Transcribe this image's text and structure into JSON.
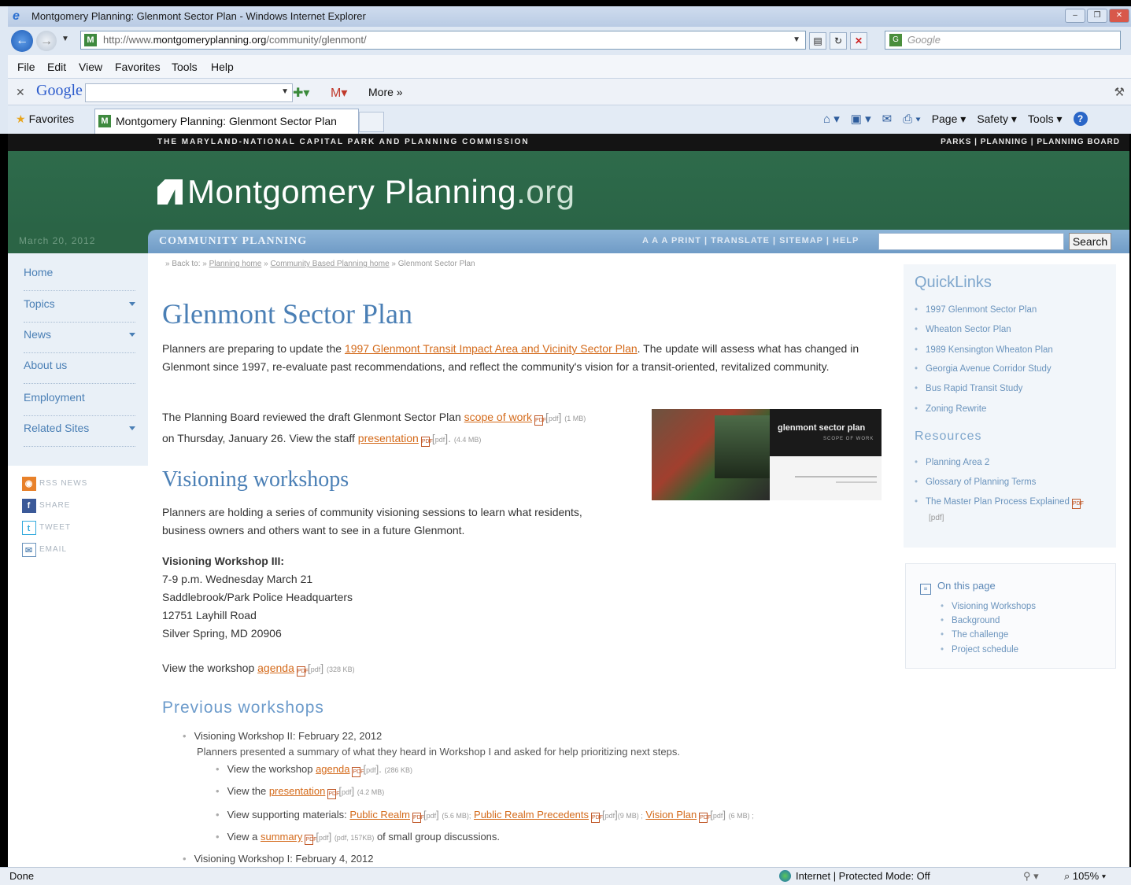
{
  "browser": {
    "title": "Montgomery Planning: Glenmont Sector Plan - Windows Internet Explorer",
    "url_prefix": "http://www.",
    "url_domain": "montgomeryplanning.org",
    "url_path": "/community/glenmont/",
    "search_placeholder": "Google",
    "menu": [
      "File",
      "Edit",
      "View",
      "Favorites",
      "Tools",
      "Help"
    ],
    "google_toolbar": {
      "logo": "Google",
      "more": "More »"
    },
    "favorites_label": "Favorites",
    "tab_title": "Montgomery Planning: Glenmont Sector Plan",
    "commands": {
      "page": "Page ▾",
      "safety": "Safety ▾",
      "tools": "Tools ▾"
    },
    "status": {
      "left": "Done",
      "zone": "Internet | Protected Mode: Off",
      "zoom": "105%"
    }
  },
  "site": {
    "org_bar": "THE MARYLAND-NATIONAL CAPITAL PARK AND PLANNING COMMISSION",
    "org_links": "PARKS  |  PLANNING  |  PLANNING BOARD",
    "logo_main": "Montgomery Planning",
    "logo_org": ".org",
    "date": "March 20, 2012",
    "section_title": "COMMUNITY PLANNING",
    "tools": "A A A  PRINT | TRANSLATE | SITEMAP | HELP",
    "search_button": "Search"
  },
  "leftnav": [
    {
      "label": "Home"
    },
    {
      "label": "Topics"
    },
    {
      "label": "News"
    },
    {
      "label": "About us"
    },
    {
      "label": "Employment"
    },
    {
      "label": "Related Sites"
    }
  ],
  "social": [
    "RSS NEWS",
    "SHARE",
    "TWEET",
    "EMAIL"
  ],
  "breadcrumb": {
    "prefix": "» Back to: »",
    "planning_home": "Planning home",
    "cbp_home": "Community Based Planning home",
    "current": "» Glenmont Sector Plan"
  },
  "content": {
    "title": "Glenmont Sector Plan",
    "intro_pre": "Planners are preparing to update the ",
    "intro_link": "1997 Glenmont Transit Impact Area and Vicinity Sector Plan",
    "intro_post": ". The update will assess what has changed in Glenmont since 1997, re-evaluate past recommendations, and reflect the community's vision for a transit-oriented, revitalized community.",
    "board_pre": "The Planning Board reviewed the draft Glenmont Sector Plan ",
    "board_link": "scope of work",
    "board_size1": "(1 MB)",
    "board_mid": "on Thursday, January 26. View the staff ",
    "board_link2": "presentation",
    "board_size2": "(4.4 MB)",
    "thumb_title": "glenmont sector plan",
    "thumb_sub": "SCOPE OF WORK",
    "visioning_title": "Visioning workshops",
    "visioning_text": "Planners are holding a series of community visioning sessions to learn what residents, business owners and others want to see in a future Glenmont.",
    "ws_head": "Visioning Workshop III:",
    "ws_time": "7-9 p.m. Wednesday March 21",
    "ws_place": "Saddlebrook/Park Police Headquarters",
    "ws_addr1": "12751 Layhill Road",
    "ws_addr2": "Silver Spring, MD 20906",
    "agenda_pre": "View the workshop ",
    "agenda_link": "agenda",
    "agenda_size": "(328 KB)",
    "prev_title": "Previous workshops",
    "ws2_title": "Visioning Workshop II: February 22, 2012",
    "ws2_text": "Planners presented a summary of what they heard in Workshop I and asked for help prioritizing next steps.",
    "ws2_agenda_pre": "View the workshop ",
    "ws2_agenda_link": "agenda",
    "ws2_agenda_size": "(286 KB)",
    "ws2_pres_pre": "View the ",
    "ws2_pres_link": "presentation",
    "ws2_pres_size": "(4.2 MB)",
    "ws2_mat_pre": "View supporting materials: ",
    "ws2_mat_link1": "Public Realm",
    "ws2_mat_size1": "(5.6 MB);",
    "ws2_mat_link2": "Public Realm Precedents",
    "ws2_mat_size2": "(9 MB) ;",
    "ws2_mat_link3": "Vision Plan",
    "ws2_mat_size3": "(6 MB) ;",
    "ws2_sum_pre": "View a ",
    "ws2_sum_link": "summary",
    "ws2_sum_size": "(pdf, 157KB)",
    "ws2_sum_post": " of small group discussions.",
    "ws1_title": "Visioning Workshop I: February 4, 2012"
  },
  "quicklinks": {
    "title": "QuickLinks",
    "items": [
      "1997 Glenmont Sector Plan",
      "Wheaton Sector Plan",
      "1989 Kensington Wheaton Plan",
      "Georgia Avenue Corridor Study",
      "Bus Rapid Transit Study",
      "Zoning Rewrite"
    ],
    "resources_title": "Resources",
    "resources": [
      "Planning Area 2",
      "Glossary of Planning Terms",
      "The Master Plan Process Explained"
    ],
    "resources_pdf": "[pdf]"
  },
  "on_this_page": {
    "title": "On this page",
    "items": [
      "Visioning Workshops",
      "Background",
      "The challenge",
      "Project schedule"
    ]
  }
}
